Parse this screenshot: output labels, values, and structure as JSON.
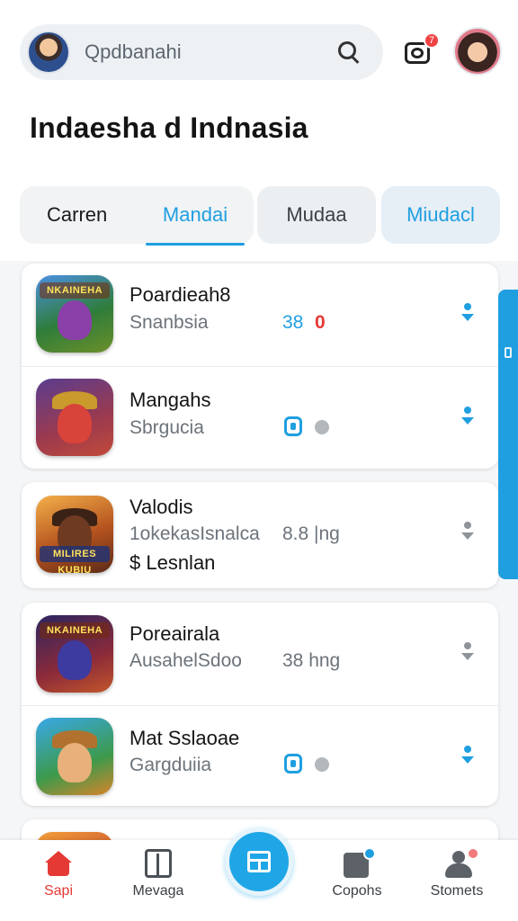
{
  "header": {
    "search_placeholder": "Qpdbanahi",
    "camera_badge": "7"
  },
  "page_title": "Indaesha d Indnasia",
  "tabs": [
    {
      "label": "Carren"
    },
    {
      "label": "Mandai"
    },
    {
      "label": "Mudaa"
    },
    {
      "label": "Miudacl"
    }
  ],
  "apps": [
    {
      "name": "Poardieah8",
      "sub": "Snanbsia",
      "stat": "38",
      "stat2": "0",
      "icon_banner": "NKAINEHA"
    },
    {
      "name": "Mangahs",
      "sub": "Sbrgucia"
    },
    {
      "name": "Valodis",
      "sub": "1okekasIsnalca",
      "stat": "8.8 |ng",
      "extra": "$ Lesnlan",
      "icon_banner": "MILIRES KUBIU"
    },
    {
      "name": "Poreairala",
      "sub": "AusahelSdoo",
      "stat": "38 hng",
      "icon_banner": "NKAINEHA"
    },
    {
      "name": "Mat Sslaoae",
      "sub": "Gargduiia"
    }
  ],
  "bottom_nav": [
    {
      "label": "Sapi"
    },
    {
      "label": "Mevaga"
    },
    {
      "label": "Copohs"
    },
    {
      "label": "Stomets"
    }
  ],
  "colors": {
    "accent": "#1f9fe0",
    "active_nav": "#e53935",
    "badge": "#ef4343"
  }
}
